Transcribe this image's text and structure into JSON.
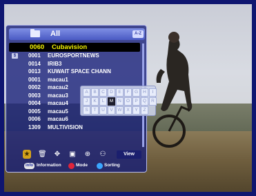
{
  "header": {
    "group_label": "All",
    "sort_badge": "A-Z"
  },
  "channels": [
    {
      "number": "0060",
      "name": "Cubavision",
      "selected": true
    },
    {
      "number": "0001",
      "name": "EUROSPORTNEWS",
      "icon": "scrambled-icon"
    },
    {
      "number": "0014",
      "name": "IRIB3"
    },
    {
      "number": "0013",
      "name": "KUWAIT SPACE CHANN"
    },
    {
      "number": "0001",
      "name": "macau1"
    },
    {
      "number": "0002",
      "name": "macau2"
    },
    {
      "number": "0003",
      "name": "macau3"
    },
    {
      "number": "0004",
      "name": "macau4"
    },
    {
      "number": "0005",
      "name": "macau5"
    },
    {
      "number": "0006",
      "name": "macau6"
    },
    {
      "number": "1309",
      "name": "MULTIVISION"
    }
  ],
  "toolbar": {
    "icons": [
      "favorite-icon",
      "delete-icon",
      "move-icon",
      "edit-icon",
      "lock-icon",
      "users-icon"
    ],
    "view_label": "View"
  },
  "legend": {
    "info_badge": "info",
    "info_label": "Information",
    "mode_label": "Mode",
    "sorting_label": "Sorting"
  },
  "keyboard": {
    "keys": [
      "A",
      "B",
      "C",
      "D",
      "E",
      "F",
      "G",
      "H",
      "I",
      "J",
      "K",
      "L",
      "M",
      "N",
      "O",
      "P",
      "Q",
      "R",
      "S",
      "T",
      "U",
      "V",
      "W",
      "X",
      "Y",
      "Z"
    ],
    "active": "M"
  },
  "colors": {
    "selected_text": "#f3f300",
    "panel": "#161e78",
    "frame": "#0f1670",
    "red_button": "#e0243a",
    "blue_button": "#3aa6ff"
  }
}
